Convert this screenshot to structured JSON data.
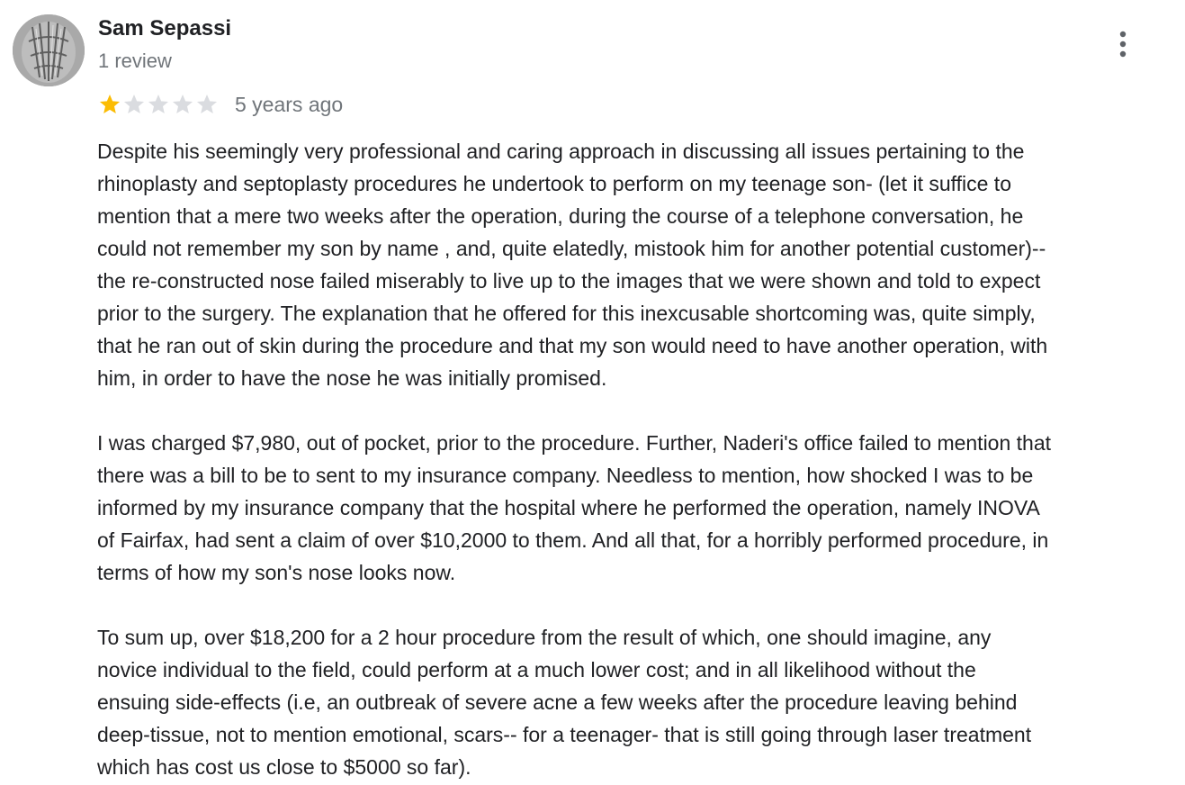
{
  "author": {
    "name": "Sam Sepassi",
    "review_count": "1 review",
    "avatar_icon": "user-photo-avatar"
  },
  "menu": {
    "icon": "more-vert-icon"
  },
  "rating": {
    "stars_filled": 1,
    "stars_total": 5,
    "filled_color": "#fbbc04",
    "empty_color": "#dadce0"
  },
  "review": {
    "date": "5 years ago",
    "paragraphs": [
      "Despite his seemingly very professional  and caring approach in discussing all issues pertaining to the\nrhinoplasty and septoplasty procedures he undertook to perform on my teenage son- (let it suffice to\nmention that a mere two weeks after the operation, during the course of a telephone conversation, he\ncould not remember my son by name , and, quite elatedly, mistook him for another potential customer)--\nthe re-constructed nose failed miserably to live up to the images that we were shown and told to expect\nprior to the surgery. The explanation that he offered for this inexcusable shortcoming was, quite simply,\nthat he ran out of skin during the procedure and that my son would need to have another operation, with\nhim, in order to have the nose he was initially promised.",
      "I was charged $7,980, out of pocket, prior to the procedure. Further, Naderi's office failed to mention that\nthere was a bill to be to sent to my insurance company. Needless to mention, how shocked I was to be\ninformed by my insurance company that the hospital where he performed the operation, namely INOVA\nof Fairfax, had sent a claim of over $10,2000 to them. And all that, for a horribly performed procedure, in\nterms of how my son's nose looks now.",
      "To sum up, over $18,200 for a 2 hour procedure from the result of which, one should imagine, any\nnovice  individual to the field, could perform at a much lower cost; and in all likelihood without the\nensuing side-effects (i.e, an outbreak of severe acne a few weeks after the procedure leaving behind\ndeep-tissue, not to mention emotional, scars-- for a teenager- that is still going through laser treatment\nwhich has cost us close to $5000 so far)."
    ]
  }
}
